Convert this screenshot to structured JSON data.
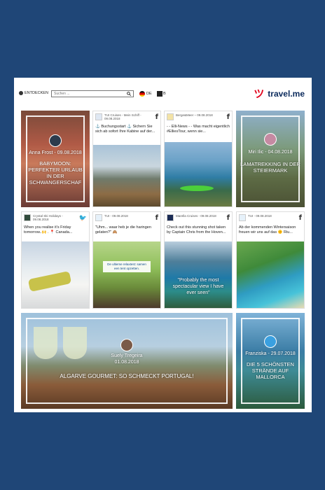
{
  "topbar": {
    "entdecken": "ENTDECKEN",
    "search_placeholder": "Suchen ...",
    "lang": "DE",
    "info": "B",
    "brand": "travel.me",
    "brand_mark": "ツ"
  },
  "features": {
    "anna": {
      "byline": "Anna Frost - 09.08.2018",
      "title": "BABYMOON: PERFEKTER URLAUB IN DER SCHWANGERSCHAF"
    },
    "miri": {
      "byline": "Miri Ilic - 04.08.2018",
      "title": "LAMATREKKING IN DER STEIERMARK"
    },
    "suely": {
      "name": "Suely Tregeira",
      "date": "01.08.2018",
      "title": "ALGARVE GOURMET: SO SCHMECKT PORTUGAL!"
    },
    "franziska": {
      "byline": "Franziska - 29.07.2018",
      "title": "DIE 5 SCHÖNSTEN STRÄNDE AUF MALLORCA"
    }
  },
  "posts": [
    {
      "source": "TUI Cruises - Mein Schiff - 09.08.2018",
      "network": "f",
      "text": "⚓ Buchungsstart ⚓ Sichern Sie sich ab sofort Ihre Kabine auf der..."
    },
    {
      "source": "Berge&Meer – 09.08.2018",
      "network": "f",
      "text": "- - Elli-News - - Was macht eigentlich #ElliesTour, wenn sie..."
    },
    {
      "source": "Crystal Ski Holidays - 09.08.2018",
      "network": "🐦",
      "text": "When you realise it's Friday tomorrow..🙌 . 📍 Canada..."
    },
    {
      "source": "TUI - 09.08.2018",
      "network": "f",
      "text": "\"Uhm... waar heb je die haringen gelaten?\" 🙈",
      "image_caption": "De ultieme relaxtest: samen een tent opzetten."
    },
    {
      "source": "Marella Cruises - 09.08.2018",
      "network": "f",
      "text": "Check out this stunning shot taken by Captain Chris from the Hoven...",
      "image_quote": "\"Probably the most spectacular view I have ever seen\""
    },
    {
      "source": "TUI - 09.08.2018",
      "network": "f",
      "text": "Ab der kommenden Wintersaison freuen wir uns auf das 🌞 Riu..."
    }
  ]
}
